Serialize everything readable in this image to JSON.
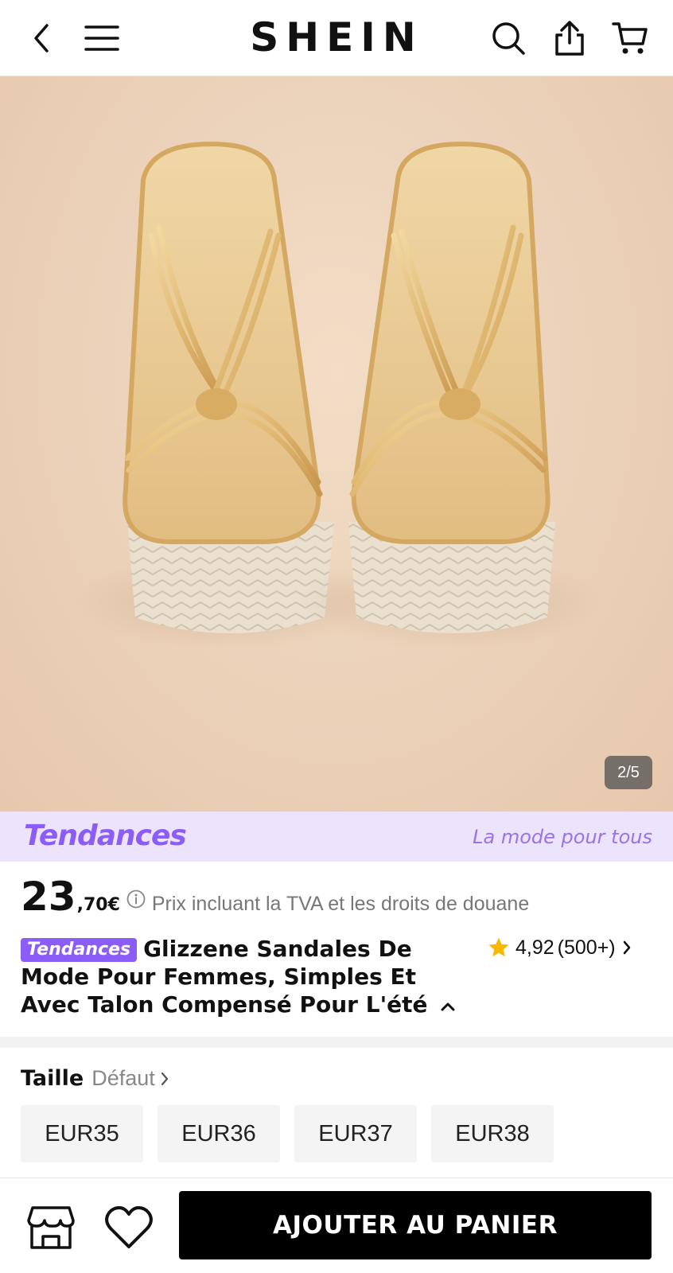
{
  "header": {
    "logo": "SHEIN",
    "icons": [
      "back-icon",
      "menu-icon",
      "search-icon",
      "share-icon",
      "cart-icon"
    ]
  },
  "gallery": {
    "counter": "2/5"
  },
  "trend_banner": {
    "logo_text": "Tendances",
    "tagline": "La mode pour tous",
    "accent_color": "#8b5cf6",
    "background": "#ece3fd"
  },
  "price": {
    "integer": "23",
    "decimal": ",70€",
    "note": "Prix incluant la TVA et les droits de douane"
  },
  "product": {
    "badge": "Tendances",
    "title": "Glizzene Sandales De Mode Pour Femmes, Simples Et Avec Talon Compensé Pour L'été",
    "rating": "4,92",
    "review_count": "(500+)"
  },
  "size": {
    "label": "Taille",
    "default_label": "Défaut",
    "options": [
      "EUR35",
      "EUR36",
      "EUR37",
      "EUR38"
    ]
  },
  "bottom_bar": {
    "add_to_cart": "AJOUTER AU PANIER"
  }
}
